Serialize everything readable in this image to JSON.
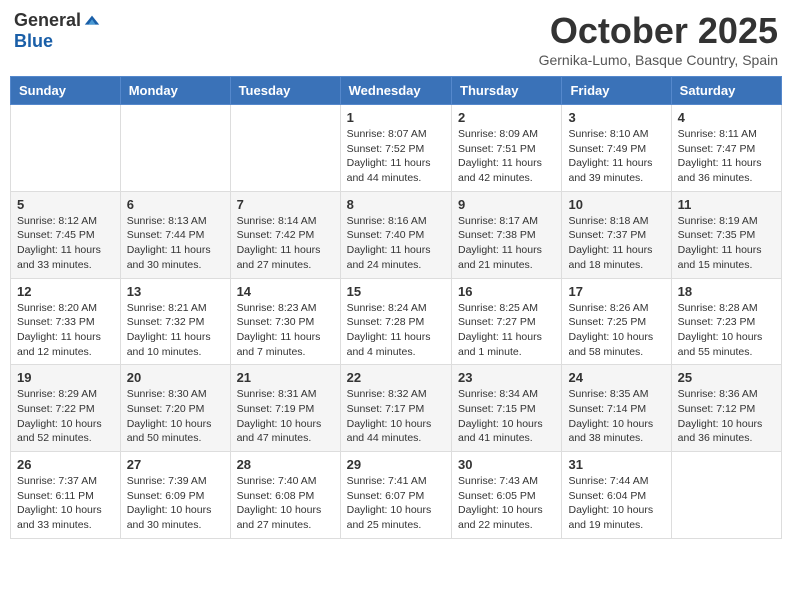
{
  "header": {
    "logo_general": "General",
    "logo_blue": "Blue",
    "month_title": "October 2025",
    "location": "Gernika-Lumo, Basque Country, Spain"
  },
  "days_of_week": [
    "Sunday",
    "Monday",
    "Tuesday",
    "Wednesday",
    "Thursday",
    "Friday",
    "Saturday"
  ],
  "weeks": [
    [
      {
        "day": "",
        "info": ""
      },
      {
        "day": "",
        "info": ""
      },
      {
        "day": "",
        "info": ""
      },
      {
        "day": "1",
        "info": "Sunrise: 8:07 AM\nSunset: 7:52 PM\nDaylight: 11 hours and 44 minutes."
      },
      {
        "day": "2",
        "info": "Sunrise: 8:09 AM\nSunset: 7:51 PM\nDaylight: 11 hours and 42 minutes."
      },
      {
        "day": "3",
        "info": "Sunrise: 8:10 AM\nSunset: 7:49 PM\nDaylight: 11 hours and 39 minutes."
      },
      {
        "day": "4",
        "info": "Sunrise: 8:11 AM\nSunset: 7:47 PM\nDaylight: 11 hours and 36 minutes."
      }
    ],
    [
      {
        "day": "5",
        "info": "Sunrise: 8:12 AM\nSunset: 7:45 PM\nDaylight: 11 hours and 33 minutes."
      },
      {
        "day": "6",
        "info": "Sunrise: 8:13 AM\nSunset: 7:44 PM\nDaylight: 11 hours and 30 minutes."
      },
      {
        "day": "7",
        "info": "Sunrise: 8:14 AM\nSunset: 7:42 PM\nDaylight: 11 hours and 27 minutes."
      },
      {
        "day": "8",
        "info": "Sunrise: 8:16 AM\nSunset: 7:40 PM\nDaylight: 11 hours and 24 minutes."
      },
      {
        "day": "9",
        "info": "Sunrise: 8:17 AM\nSunset: 7:38 PM\nDaylight: 11 hours and 21 minutes."
      },
      {
        "day": "10",
        "info": "Sunrise: 8:18 AM\nSunset: 7:37 PM\nDaylight: 11 hours and 18 minutes."
      },
      {
        "day": "11",
        "info": "Sunrise: 8:19 AM\nSunset: 7:35 PM\nDaylight: 11 hours and 15 minutes."
      }
    ],
    [
      {
        "day": "12",
        "info": "Sunrise: 8:20 AM\nSunset: 7:33 PM\nDaylight: 11 hours and 12 minutes."
      },
      {
        "day": "13",
        "info": "Sunrise: 8:21 AM\nSunset: 7:32 PM\nDaylight: 11 hours and 10 minutes."
      },
      {
        "day": "14",
        "info": "Sunrise: 8:23 AM\nSunset: 7:30 PM\nDaylight: 11 hours and 7 minutes."
      },
      {
        "day": "15",
        "info": "Sunrise: 8:24 AM\nSunset: 7:28 PM\nDaylight: 11 hours and 4 minutes."
      },
      {
        "day": "16",
        "info": "Sunrise: 8:25 AM\nSunset: 7:27 PM\nDaylight: 11 hours and 1 minute."
      },
      {
        "day": "17",
        "info": "Sunrise: 8:26 AM\nSunset: 7:25 PM\nDaylight: 10 hours and 58 minutes."
      },
      {
        "day": "18",
        "info": "Sunrise: 8:28 AM\nSunset: 7:23 PM\nDaylight: 10 hours and 55 minutes."
      }
    ],
    [
      {
        "day": "19",
        "info": "Sunrise: 8:29 AM\nSunset: 7:22 PM\nDaylight: 10 hours and 52 minutes."
      },
      {
        "day": "20",
        "info": "Sunrise: 8:30 AM\nSunset: 7:20 PM\nDaylight: 10 hours and 50 minutes."
      },
      {
        "day": "21",
        "info": "Sunrise: 8:31 AM\nSunset: 7:19 PM\nDaylight: 10 hours and 47 minutes."
      },
      {
        "day": "22",
        "info": "Sunrise: 8:32 AM\nSunset: 7:17 PM\nDaylight: 10 hours and 44 minutes."
      },
      {
        "day": "23",
        "info": "Sunrise: 8:34 AM\nSunset: 7:15 PM\nDaylight: 10 hours and 41 minutes."
      },
      {
        "day": "24",
        "info": "Sunrise: 8:35 AM\nSunset: 7:14 PM\nDaylight: 10 hours and 38 minutes."
      },
      {
        "day": "25",
        "info": "Sunrise: 8:36 AM\nSunset: 7:12 PM\nDaylight: 10 hours and 36 minutes."
      }
    ],
    [
      {
        "day": "26",
        "info": "Sunrise: 7:37 AM\nSunset: 6:11 PM\nDaylight: 10 hours and 33 minutes."
      },
      {
        "day": "27",
        "info": "Sunrise: 7:39 AM\nSunset: 6:09 PM\nDaylight: 10 hours and 30 minutes."
      },
      {
        "day": "28",
        "info": "Sunrise: 7:40 AM\nSunset: 6:08 PM\nDaylight: 10 hours and 27 minutes."
      },
      {
        "day": "29",
        "info": "Sunrise: 7:41 AM\nSunset: 6:07 PM\nDaylight: 10 hours and 25 minutes."
      },
      {
        "day": "30",
        "info": "Sunrise: 7:43 AM\nSunset: 6:05 PM\nDaylight: 10 hours and 22 minutes."
      },
      {
        "day": "31",
        "info": "Sunrise: 7:44 AM\nSunset: 6:04 PM\nDaylight: 10 hours and 19 minutes."
      },
      {
        "day": "",
        "info": ""
      }
    ]
  ]
}
